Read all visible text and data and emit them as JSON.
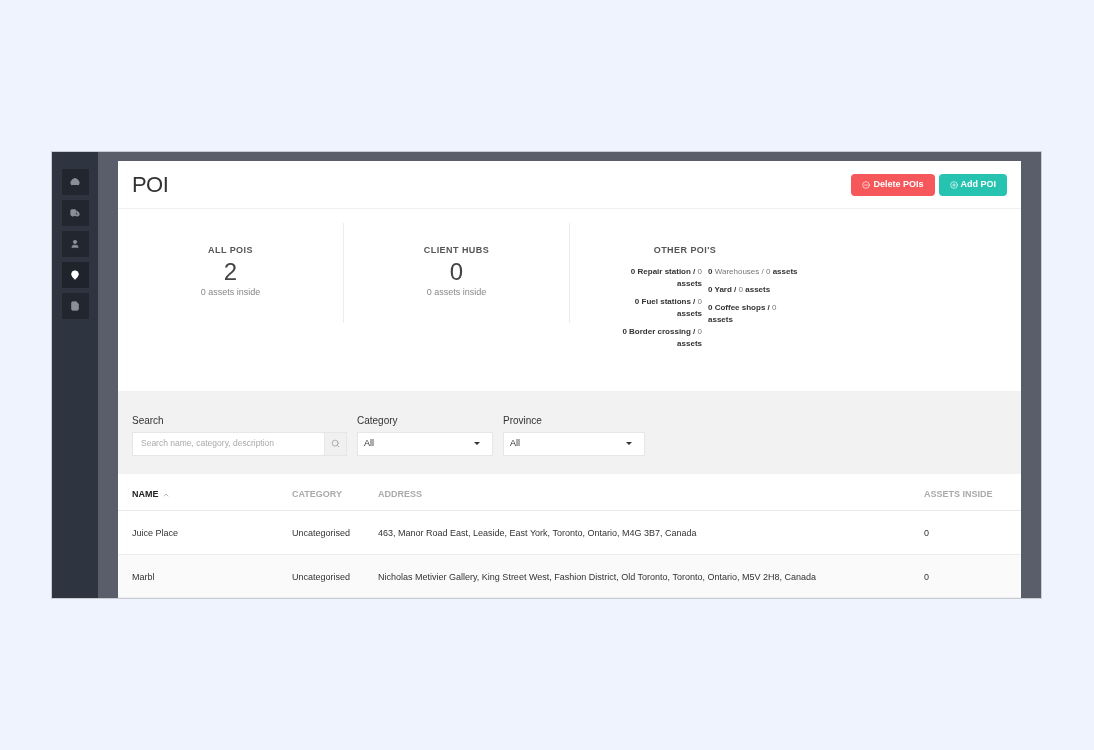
{
  "sidebar": {
    "items": [
      {
        "selected": false
      },
      {
        "selected": false
      },
      {
        "selected": false
      },
      {
        "selected": true
      },
      {
        "selected": false
      }
    ]
  },
  "header": {
    "title": "POI",
    "buttons": [
      {
        "kind": "delete",
        "label": "Delete POIs"
      },
      {
        "kind": "add",
        "label": "Add POI"
      }
    ]
  },
  "stats": [
    {
      "label": "ALL POIS",
      "value": "2",
      "note": "0 assets inside"
    },
    {
      "label": "CLIENT HUBS",
      "value": "0",
      "note": "0 assets inside"
    }
  ],
  "other_pois": {
    "label": "OTHER POI'S",
    "left": [
      "**0 Repair station /** 0 **assets**",
      "**0 Fuel stations /** 0 **assets**",
      "**0 Border crossing /** 0 **assets**"
    ],
    "right": [
      "**0** Warehouses / 0 **assets**",
      "**0 Yard /** 0 **assets**",
      "**0 Coffee shops /** 0 **assets**"
    ]
  },
  "filters": {
    "search": {
      "label": "Search",
      "placeholder": "Search name, category, description"
    },
    "category": {
      "label": "Category",
      "value": "All"
    },
    "province": {
      "label": "Province",
      "value": "All"
    }
  },
  "table": {
    "columns": [
      {
        "label": "NAME",
        "sorted": true
      },
      {
        "label": "CATEGORY",
        "sorted": false
      },
      {
        "label": "ADDRESS",
        "sorted": false
      },
      {
        "label": "ASSETS INSIDE",
        "sorted": false
      }
    ],
    "rows": [
      [
        "Juice Place",
        "Uncategorised",
        "463, Manor Road East, Leaside, East York, Toronto, Ontario, M4G 3B7, Canada",
        "0"
      ],
      [
        "Marbl",
        "Uncategorised",
        "Nicholas Metivier Gallery, King Street West, Fashion District, Old Toronto, Toronto, Ontario, M5V 2H8, Canada",
        "0"
      ]
    ]
  }
}
